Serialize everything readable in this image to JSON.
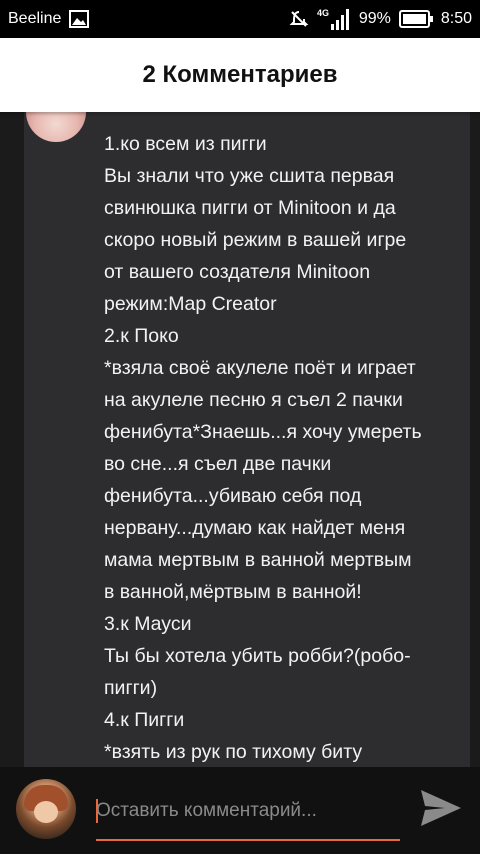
{
  "status_bar": {
    "carrier": "Beeline",
    "network": "4G",
    "battery_percent": "99%",
    "time": "8:50",
    "icons": [
      "image-icon",
      "muted-icon",
      "signal-icon",
      "battery-icon"
    ]
  },
  "header": {
    "title": "2 Комментариев"
  },
  "comment": {
    "lines": [
      "1.ко всем из пигги",
      "Вы знали что уже сшита первая",
      "свинюшка пигги от Minitoon и да",
      "скоро новый режим в вашей игре",
      "от вашего создателя Minitoon",
      "режим:Map Creator",
      "2.к Поко",
      "*взяла своё акулеле поёт и играет",
      "на акулеле песню я съел 2 пачки",
      "фенибута*Знаешь...я хочу умереть",
      "во сне...я съел две пачки",
      "фенибута...убиваю себя под",
      "нервану...думаю как найдет меня",
      "мама мертвым в ванной мертвым",
      "в ванной,мёртвым в ванной!",
      "3.к Мауси",
      "Ты бы хотела убить робби?(робо-",
      "пигги)",
      "4.к Пигги",
      "*взять из рук по тихому биту"
    ]
  },
  "comment_input": {
    "placeholder": "Оставить комментарий..."
  },
  "colors": {
    "accent": "#e8693a",
    "card": "#2d2d30",
    "background": "#1b1b1b"
  }
}
